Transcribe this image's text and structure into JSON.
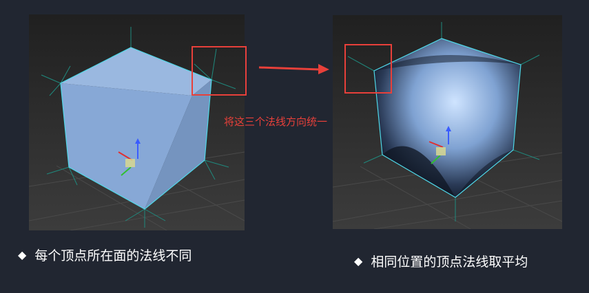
{
  "annotation": "将这三个法线方向统一",
  "captions": {
    "bullet": "◆",
    "left": "每个顶点所在面的法线不同",
    "right": "相同位置的顶点法线取平均"
  },
  "colors": {
    "background": "#212631",
    "highlight": "#e8403a",
    "cube_face": "#86a8d4",
    "cube_edge": "#4fd8e8",
    "normal_line": "#1f8a7e"
  }
}
